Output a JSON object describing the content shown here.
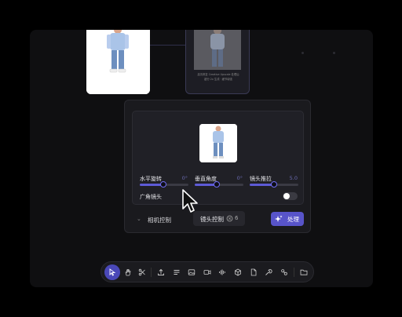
{
  "canvas": {
    "right_node_caption_line1": "高清修复 Creative Upscale 处理后",
    "right_node_caption_line2": "超分 2x 生成 · 细节增强"
  },
  "panel": {
    "sliders": [
      {
        "label": "水平旋转",
        "value": "0°",
        "fill": 0.48
      },
      {
        "label": "垂直角度",
        "value": "0°",
        "fill": 0.45
      },
      {
        "label": "镜头推拉",
        "value": "5.0",
        "fill": 0.5
      }
    ],
    "wide_angle_label": "广角镜头",
    "wide_angle_on": false,
    "camera_control_label": "相机控制",
    "chip_label": "镜头控制",
    "chip_count": "6",
    "process_label": "处理"
  },
  "toolbar": {
    "items": [
      "select-tool-icon",
      "hand-tool-icon",
      "scissors-icon",
      "upload-icon",
      "text-lines-icon",
      "image-icon",
      "video-icon",
      "audio-wave-icon",
      "cube-icon",
      "document-icon",
      "wrench-icon",
      "link-icon",
      "folder-icon"
    ],
    "active": "select-tool-icon"
  },
  "colors": {
    "accent": "#5854c9",
    "slider": "#5d5ad6",
    "background": "#0f0f11"
  }
}
